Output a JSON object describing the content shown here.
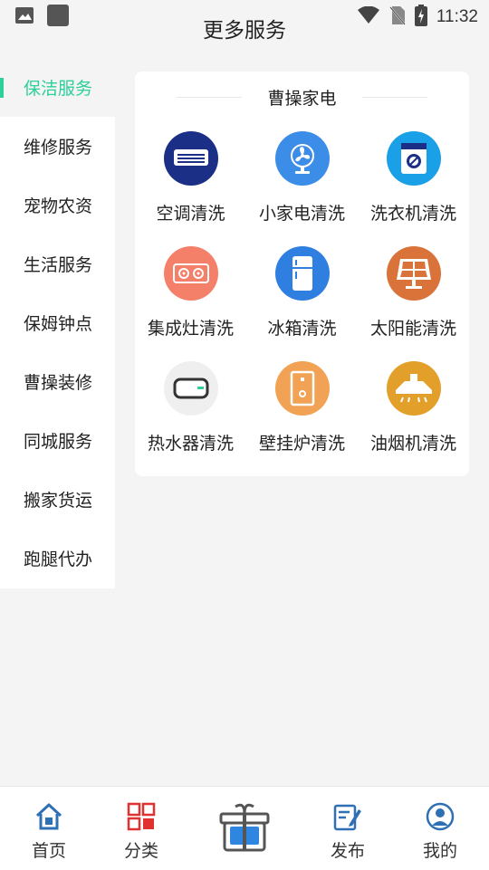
{
  "status_bar": {
    "time": "11:32"
  },
  "header": {
    "title": "更多服务"
  },
  "sidebar": {
    "items": [
      {
        "label": "保洁服务",
        "active": true
      },
      {
        "label": "维修服务"
      },
      {
        "label": "宠物农资"
      },
      {
        "label": "生活服务"
      },
      {
        "label": "保姆钟点"
      },
      {
        "label": "曹操装修"
      },
      {
        "label": "同城服务"
      },
      {
        "label": "搬家货运"
      },
      {
        "label": "跑腿代办"
      }
    ]
  },
  "section": {
    "title": "曹操家电",
    "items": [
      {
        "label": "空调清洗",
        "icon": "air-conditioner-icon",
        "color": "#1b2f86"
      },
      {
        "label": "小家电清洗",
        "icon": "fan-icon",
        "color": "#3b8de8"
      },
      {
        "label": "洗衣机清洗",
        "icon": "washing-machine-icon",
        "color": "#1aa0e6"
      },
      {
        "label": "集成灶清洗",
        "icon": "stove-icon",
        "color": "#f4806a"
      },
      {
        "label": "冰箱清洗",
        "icon": "refrigerator-icon",
        "color": "#2f7fe0"
      },
      {
        "label": "太阳能清洗",
        "icon": "solar-panel-icon",
        "color": "#d9733a"
      },
      {
        "label": "热水器清洗",
        "icon": "water-heater-icon",
        "color": "#efefef"
      },
      {
        "label": "壁挂炉清洗",
        "icon": "wall-boiler-icon",
        "color": "#f2a254"
      },
      {
        "label": "油烟机清洗",
        "icon": "range-hood-icon",
        "color": "#e2a02a"
      }
    ]
  },
  "bottom_nav": {
    "items": [
      {
        "label": "首页",
        "icon": "home-icon"
      },
      {
        "label": "分类",
        "icon": "category-icon"
      },
      {
        "label": "",
        "icon": "gift-box-icon"
      },
      {
        "label": "发布",
        "icon": "publish-icon"
      },
      {
        "label": "我的",
        "icon": "profile-icon"
      }
    ]
  },
  "colors": {
    "accent": "#2dcf9a",
    "nav_blue": "#2f6fb4",
    "nav_red": "#e03030"
  }
}
